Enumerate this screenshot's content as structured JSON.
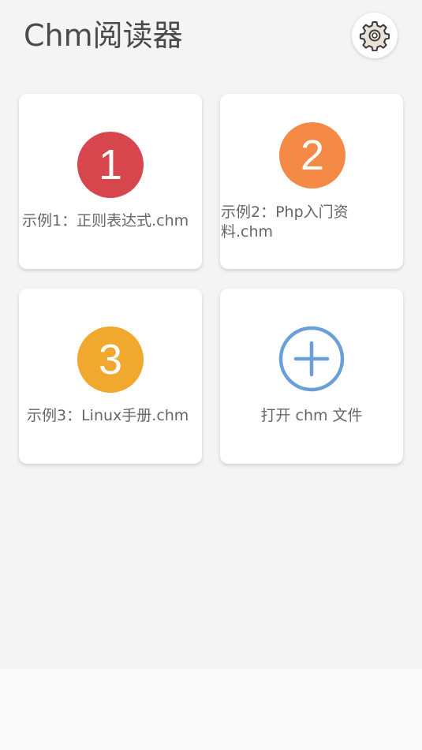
{
  "header": {
    "title": "Chm阅读器",
    "settings_icon": "gear-icon"
  },
  "cards": [
    {
      "badge": "1",
      "label": "示例1：正则表达式.chm",
      "color": "#d6464c"
    },
    {
      "badge": "2",
      "label": "示例2：Php入门资料.chm",
      "color": "#f48a45"
    },
    {
      "badge": "3",
      "label": "示例3：Linux手册.chm",
      "color": "#f0a92e"
    },
    {
      "icon": "add-circle-icon",
      "label": "打开 chm 文件",
      "color": "#6a9fd8"
    }
  ]
}
